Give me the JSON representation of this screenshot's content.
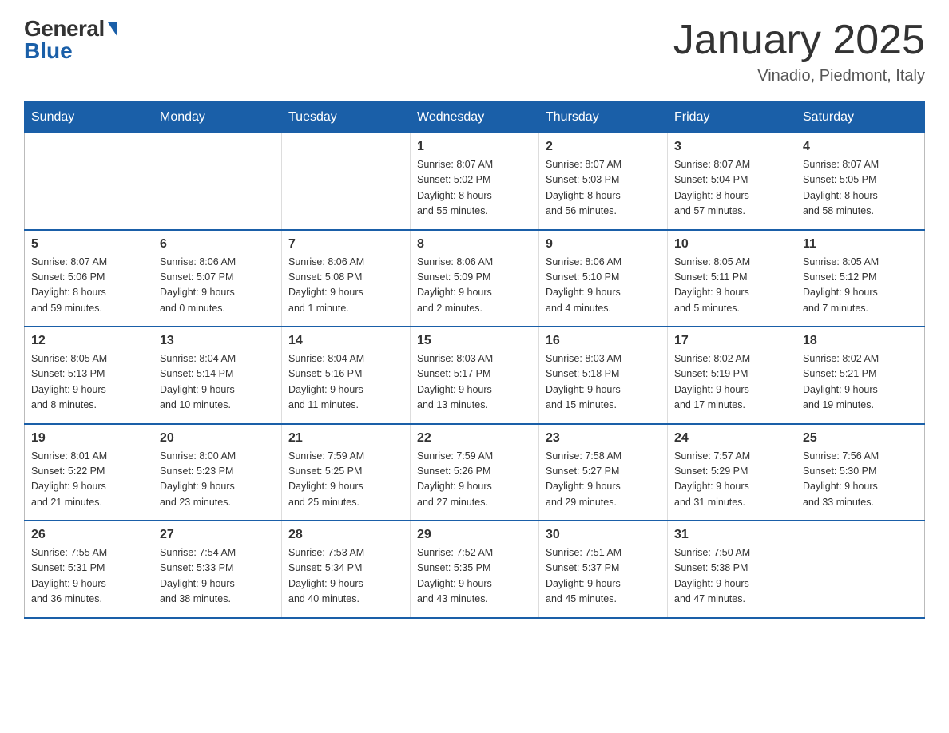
{
  "header": {
    "logo_general": "General",
    "logo_blue": "Blue",
    "title": "January 2025",
    "location": "Vinadio, Piedmont, Italy"
  },
  "days_of_week": [
    "Sunday",
    "Monday",
    "Tuesday",
    "Wednesday",
    "Thursday",
    "Friday",
    "Saturday"
  ],
  "weeks": [
    [
      {
        "day": "",
        "info": ""
      },
      {
        "day": "",
        "info": ""
      },
      {
        "day": "",
        "info": ""
      },
      {
        "day": "1",
        "info": "Sunrise: 8:07 AM\nSunset: 5:02 PM\nDaylight: 8 hours\nand 55 minutes."
      },
      {
        "day": "2",
        "info": "Sunrise: 8:07 AM\nSunset: 5:03 PM\nDaylight: 8 hours\nand 56 minutes."
      },
      {
        "day": "3",
        "info": "Sunrise: 8:07 AM\nSunset: 5:04 PM\nDaylight: 8 hours\nand 57 minutes."
      },
      {
        "day": "4",
        "info": "Sunrise: 8:07 AM\nSunset: 5:05 PM\nDaylight: 8 hours\nand 58 minutes."
      }
    ],
    [
      {
        "day": "5",
        "info": "Sunrise: 8:07 AM\nSunset: 5:06 PM\nDaylight: 8 hours\nand 59 minutes."
      },
      {
        "day": "6",
        "info": "Sunrise: 8:06 AM\nSunset: 5:07 PM\nDaylight: 9 hours\nand 0 minutes."
      },
      {
        "day": "7",
        "info": "Sunrise: 8:06 AM\nSunset: 5:08 PM\nDaylight: 9 hours\nand 1 minute."
      },
      {
        "day": "8",
        "info": "Sunrise: 8:06 AM\nSunset: 5:09 PM\nDaylight: 9 hours\nand 2 minutes."
      },
      {
        "day": "9",
        "info": "Sunrise: 8:06 AM\nSunset: 5:10 PM\nDaylight: 9 hours\nand 4 minutes."
      },
      {
        "day": "10",
        "info": "Sunrise: 8:05 AM\nSunset: 5:11 PM\nDaylight: 9 hours\nand 5 minutes."
      },
      {
        "day": "11",
        "info": "Sunrise: 8:05 AM\nSunset: 5:12 PM\nDaylight: 9 hours\nand 7 minutes."
      }
    ],
    [
      {
        "day": "12",
        "info": "Sunrise: 8:05 AM\nSunset: 5:13 PM\nDaylight: 9 hours\nand 8 minutes."
      },
      {
        "day": "13",
        "info": "Sunrise: 8:04 AM\nSunset: 5:14 PM\nDaylight: 9 hours\nand 10 minutes."
      },
      {
        "day": "14",
        "info": "Sunrise: 8:04 AM\nSunset: 5:16 PM\nDaylight: 9 hours\nand 11 minutes."
      },
      {
        "day": "15",
        "info": "Sunrise: 8:03 AM\nSunset: 5:17 PM\nDaylight: 9 hours\nand 13 minutes."
      },
      {
        "day": "16",
        "info": "Sunrise: 8:03 AM\nSunset: 5:18 PM\nDaylight: 9 hours\nand 15 minutes."
      },
      {
        "day": "17",
        "info": "Sunrise: 8:02 AM\nSunset: 5:19 PM\nDaylight: 9 hours\nand 17 minutes."
      },
      {
        "day": "18",
        "info": "Sunrise: 8:02 AM\nSunset: 5:21 PM\nDaylight: 9 hours\nand 19 minutes."
      }
    ],
    [
      {
        "day": "19",
        "info": "Sunrise: 8:01 AM\nSunset: 5:22 PM\nDaylight: 9 hours\nand 21 minutes."
      },
      {
        "day": "20",
        "info": "Sunrise: 8:00 AM\nSunset: 5:23 PM\nDaylight: 9 hours\nand 23 minutes."
      },
      {
        "day": "21",
        "info": "Sunrise: 7:59 AM\nSunset: 5:25 PM\nDaylight: 9 hours\nand 25 minutes."
      },
      {
        "day": "22",
        "info": "Sunrise: 7:59 AM\nSunset: 5:26 PM\nDaylight: 9 hours\nand 27 minutes."
      },
      {
        "day": "23",
        "info": "Sunrise: 7:58 AM\nSunset: 5:27 PM\nDaylight: 9 hours\nand 29 minutes."
      },
      {
        "day": "24",
        "info": "Sunrise: 7:57 AM\nSunset: 5:29 PM\nDaylight: 9 hours\nand 31 minutes."
      },
      {
        "day": "25",
        "info": "Sunrise: 7:56 AM\nSunset: 5:30 PM\nDaylight: 9 hours\nand 33 minutes."
      }
    ],
    [
      {
        "day": "26",
        "info": "Sunrise: 7:55 AM\nSunset: 5:31 PM\nDaylight: 9 hours\nand 36 minutes."
      },
      {
        "day": "27",
        "info": "Sunrise: 7:54 AM\nSunset: 5:33 PM\nDaylight: 9 hours\nand 38 minutes."
      },
      {
        "day": "28",
        "info": "Sunrise: 7:53 AM\nSunset: 5:34 PM\nDaylight: 9 hours\nand 40 minutes."
      },
      {
        "day": "29",
        "info": "Sunrise: 7:52 AM\nSunset: 5:35 PM\nDaylight: 9 hours\nand 43 minutes."
      },
      {
        "day": "30",
        "info": "Sunrise: 7:51 AM\nSunset: 5:37 PM\nDaylight: 9 hours\nand 45 minutes."
      },
      {
        "day": "31",
        "info": "Sunrise: 7:50 AM\nSunset: 5:38 PM\nDaylight: 9 hours\nand 47 minutes."
      },
      {
        "day": "",
        "info": ""
      }
    ]
  ]
}
